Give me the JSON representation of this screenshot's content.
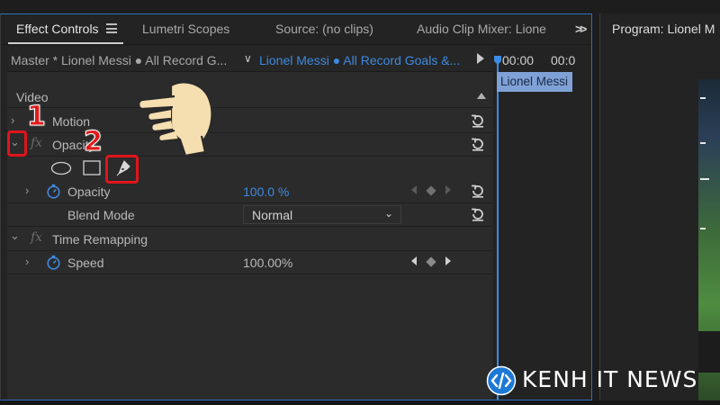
{
  "tabs": [
    {
      "label": "Effect Controls",
      "active": true
    },
    {
      "label": "Lumetri Scopes"
    },
    {
      "label": "Source: (no clips)"
    },
    {
      "label": "Audio Clip Mixer: Lione"
    }
  ],
  "program": {
    "title": "Program: Lionel M"
  },
  "clip_selector": {
    "master": "Master * Lionel Messi ● All Record G...",
    "current": "Lionel  Messi ● All Record Goals &..."
  },
  "timeline": {
    "tc1": "00:00",
    "tc2": "00:0",
    "clip": "Lionel  Messi"
  },
  "sections": {
    "video": "Video"
  },
  "motion": {
    "label": "Motion"
  },
  "opacity": {
    "label": "Opacity"
  },
  "opacity_param": {
    "label": "Opacity",
    "value": "100.0 %"
  },
  "blend": {
    "label": "Blend Mode",
    "value": "Normal"
  },
  "time_remap": {
    "label": "Time Remapping"
  },
  "speed": {
    "label": "Speed",
    "value": "100.00%"
  },
  "annotations": {
    "step1": "1",
    "step2": "2"
  },
  "watermark": {
    "text": "KENH IT NEWS"
  },
  "colors": {
    "accent": "#3e8ae0",
    "annotation": "#e0151b",
    "panel": "#2b2b2b"
  },
  "icons": [
    "menu-icon",
    "overflow-icon",
    "play-icon",
    "chevron-icon",
    "fx-icon",
    "ellipse-mask-icon",
    "rectangle-mask-icon",
    "pen-mask-icon",
    "stopwatch-icon",
    "reset-icon",
    "keyframe-icon",
    "hand-pointer-icon",
    "code-logo-icon"
  ]
}
